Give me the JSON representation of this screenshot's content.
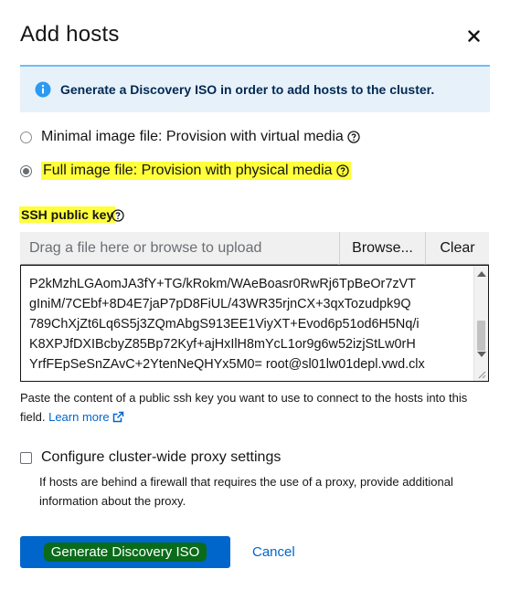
{
  "modal": {
    "title": "Add hosts",
    "close_icon": "close-icon"
  },
  "alert": {
    "icon": "info-icon",
    "text": "Generate a Discovery ISO in order to add hosts to the cluster."
  },
  "image_type": {
    "options": [
      {
        "label": "Minimal image file: Provision with virtual media",
        "checked": false
      },
      {
        "label": "Full image file: Provision with physical media",
        "checked": true
      }
    ]
  },
  "ssh": {
    "label": "SSH public key",
    "upload_placeholder": "Drag a file here or browse to upload",
    "browse_label": "Browse...",
    "clear_label": "Clear",
    "key_lines": [
      "P2kMzhLGAomJA3fY+TG/kRokm/WAeBoasr0RwRj6TpBeOr7zVT",
      "gIniM/7CEbf+8D4E7jaP7pD8FiUL/43WR35rjnCX+3qxTozudpk9Q",
      "789ChXjZt6Lq6S5j3ZQmAbgS913EE1ViyXT+Evod6p51od6H5Nq/i",
      "K8XPJfDXIBcbyZ85Bp72Kyf+ajHxIlH8mYcL1or9g6w52izjStLw0rH",
      "YrfFEpSeSnZAvC+2YtenNeQHYx5M0= root@sl01lw01depl.vwd.clx"
    ],
    "helper_text": "Paste the content of a public ssh key you want to use to connect to the hosts into this field.",
    "learn_more": "Learn more"
  },
  "proxy": {
    "label": "Configure cluster-wide proxy settings",
    "checked": false,
    "description": "If hosts are behind a firewall that requires the use of a proxy, provide additional information about the proxy."
  },
  "actions": {
    "generate_label": "Generate Discovery ISO",
    "cancel_label": "Cancel"
  },
  "colors": {
    "primary": "#0066cc",
    "alert_bg": "#e7f1fa",
    "highlight_yellow": "#ffff3a",
    "highlight_green": "#0a6b1a"
  }
}
